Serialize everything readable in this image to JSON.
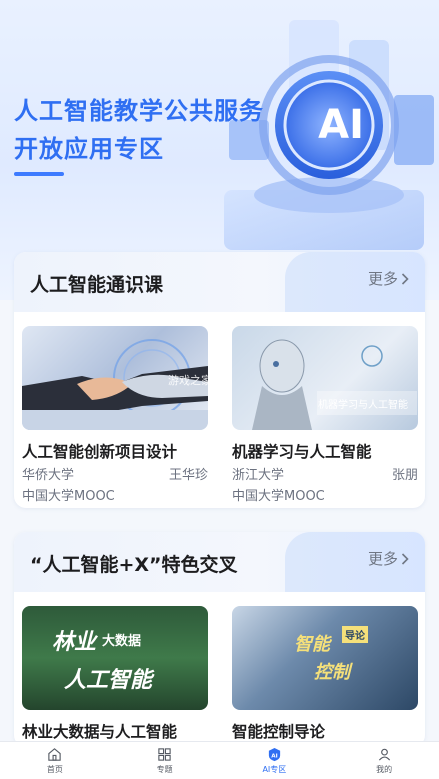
{
  "hero": {
    "title_line1": "人工智能教学公共服务",
    "title_line2": "开放应用专区",
    "badge_text": "AI"
  },
  "section1": {
    "title": "人工智能通识课",
    "more_label": "更多",
    "courses": [
      {
        "title": "人工智能创新项目设计",
        "university": "华侨大学",
        "teacher": "王华珍",
        "platform": "中国大学MOOC"
      },
      {
        "title": "机器学习与人工智能",
        "university": "浙江大学",
        "teacher": "张朋",
        "platform": "中国大学MOOC",
        "thumb_caption": "机器学习与人工智能"
      }
    ]
  },
  "section2": {
    "title": "“人工智能+X”特色交叉",
    "more_label": "更多",
    "courses": [
      {
        "title": "林业大数据与人工智能",
        "thumb_text1": "林业",
        "thumb_text2": "大数据",
        "thumb_text3": "人工智能"
      },
      {
        "title": "智能控制导论",
        "thumb_text1": "智能",
        "thumb_text2": "控制",
        "thumb_badge": "导论"
      }
    ]
  },
  "tabbar": {
    "items": [
      {
        "label": "首页",
        "icon": "home-icon"
      },
      {
        "label": "专题",
        "icon": "grid-icon"
      },
      {
        "label": "AI专区",
        "icon": "ai-shield-icon",
        "active": true
      },
      {
        "label": "我的",
        "icon": "user-icon"
      }
    ]
  },
  "watermark": "游戏之家",
  "colors": {
    "accent": "#2f6ff2",
    "title_text": "#1d1d1f",
    "meta_text": "#6c7280"
  }
}
